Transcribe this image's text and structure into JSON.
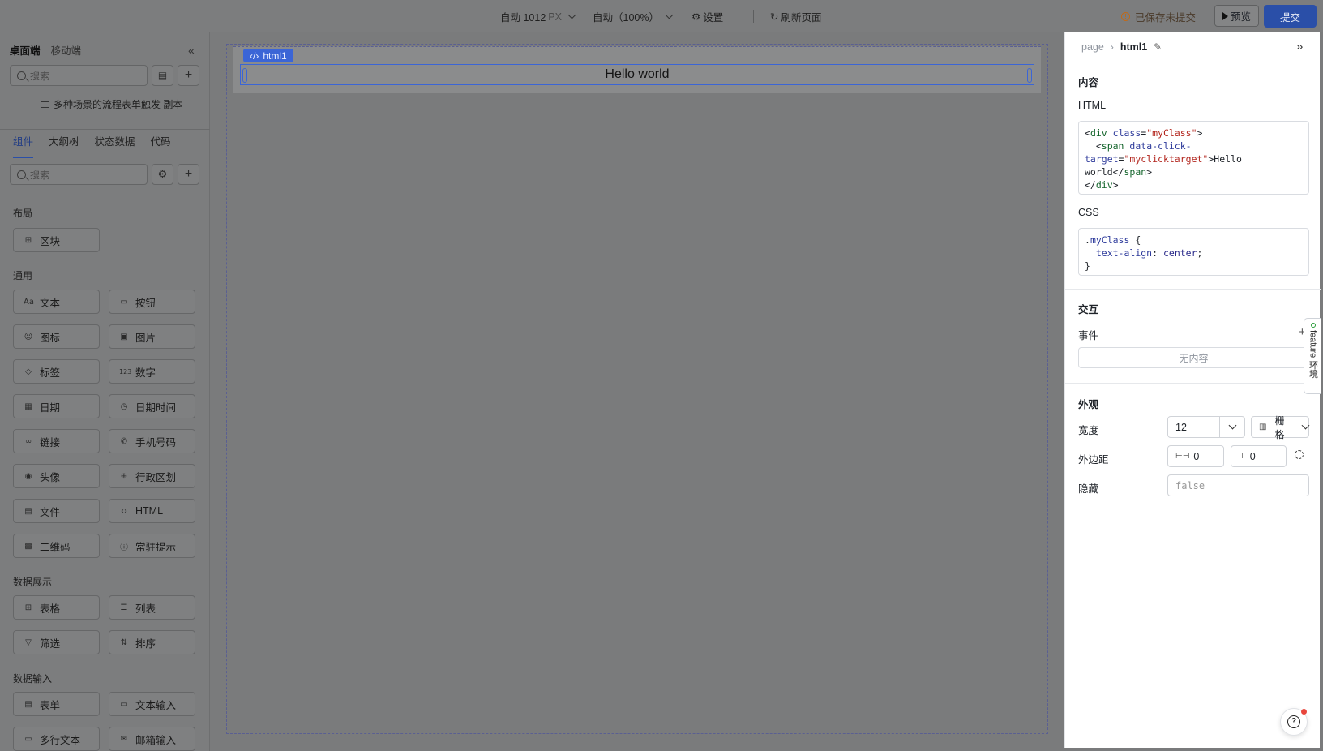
{
  "topbar": {
    "width_value": "自动 1012",
    "width_unit": "PX",
    "zoom": "自动（100%）",
    "settings": "设置",
    "refresh": "刷新页面",
    "unsaved": "已保存未提交",
    "preview": "预览",
    "submit": "提交"
  },
  "left": {
    "platform_tabs": [
      "桌面端",
      "移动端"
    ],
    "page_search_placeholder": "搜索",
    "scene_name": "多种场景的流程表单触发 副本",
    "sub_tabs": [
      "组件",
      "大纲树",
      "状态数据",
      "代码"
    ],
    "comp_search_placeholder": "搜索",
    "sections": [
      {
        "title": "布局",
        "items": [
          {
            "label": "区块",
            "icon": "grid-icon"
          }
        ]
      },
      {
        "title": "通用",
        "items": [
          {
            "label": "文本",
            "icon": "text-icon"
          },
          {
            "label": "按钮",
            "icon": "button-icon"
          },
          {
            "label": "图标",
            "icon": "smile-icon"
          },
          {
            "label": "图片",
            "icon": "image-icon"
          },
          {
            "label": "标签",
            "icon": "tag-icon"
          },
          {
            "label": "数字",
            "icon": "number-icon"
          },
          {
            "label": "日期",
            "icon": "calendar-icon"
          },
          {
            "label": "日期时间",
            "icon": "clock-icon"
          },
          {
            "label": "链接",
            "icon": "link-icon"
          },
          {
            "label": "手机号码",
            "icon": "phone-icon"
          },
          {
            "label": "头像",
            "icon": "avatar-icon"
          },
          {
            "label": "行政区划",
            "icon": "globe-icon"
          },
          {
            "label": "文件",
            "icon": "file-icon"
          },
          {
            "label": "HTML",
            "icon": "code-icon"
          },
          {
            "label": "二维码",
            "icon": "qrcode-icon"
          },
          {
            "label": "常驻提示",
            "icon": "info-icon"
          }
        ]
      },
      {
        "title": "数据展示",
        "items": [
          {
            "label": "表格",
            "icon": "table-icon"
          },
          {
            "label": "列表",
            "icon": "list-icon"
          },
          {
            "label": "筛选",
            "icon": "filter-icon"
          },
          {
            "label": "排序",
            "icon": "sort-icon"
          }
        ]
      },
      {
        "title": "数据输入",
        "items": [
          {
            "label": "表单",
            "icon": "form-icon"
          },
          {
            "label": "文本输入",
            "icon": "input-icon"
          },
          {
            "label": "多行文本",
            "icon": "textarea-icon"
          },
          {
            "label": "邮箱输入",
            "icon": "email-icon"
          }
        ]
      }
    ]
  },
  "canvas": {
    "component_tag": "html1",
    "content": "Hello world"
  },
  "right": {
    "breadcrumb": [
      "page",
      "html1"
    ],
    "content_title": "内容",
    "html_label": "HTML",
    "css_label": "CSS",
    "interaction_title": "交互",
    "events_label": "事件",
    "events_empty": "无内容",
    "appearance_title": "外观",
    "width_label": "宽度",
    "width_value": "12",
    "grid_label": "栅格",
    "margin_label": "外边距",
    "margin_h": "0",
    "margin_v": "0",
    "hidden_label": "隐藏",
    "hidden_value": "false",
    "feature_tab": "feature 环境"
  }
}
